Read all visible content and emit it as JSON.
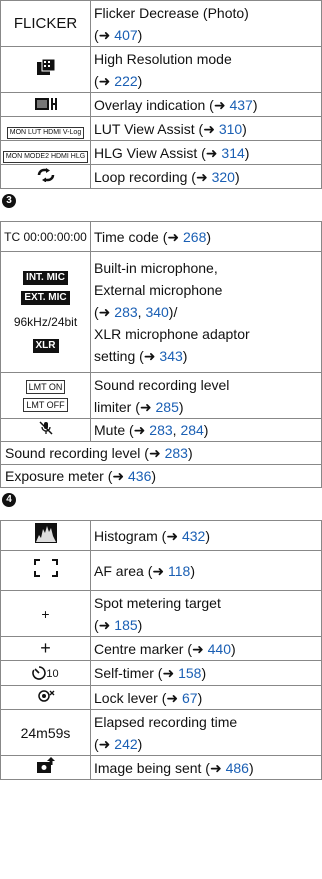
{
  "table1": [
    {
      "icon": "FLICKER",
      "desc": "Flicker Decrease (Photo)",
      "refs": [
        "407"
      ]
    },
    {
      "icon": "high-resolution-icon",
      "desc": "High Resolution mode",
      "refs": [
        "222"
      ]
    },
    {
      "icon": "overlay-icon",
      "desc": "Overlay indication",
      "refs": [
        "437"
      ]
    },
    {
      "icon": "MON LUT HDMI V-Log",
      "desc": "LUT View Assist",
      "refs": [
        "310"
      ]
    },
    {
      "icon": "MON MODE2 HDMI HLG",
      "desc": "HLG View Assist",
      "refs": [
        "314"
      ]
    },
    {
      "icon": "loop-icon",
      "desc": "Loop recording",
      "refs": [
        "320"
      ]
    }
  ],
  "section3": "3",
  "table2": {
    "timecode": {
      "icon": "TC 00:00:00:00",
      "desc": "Time code",
      "refs": [
        "268"
      ]
    },
    "mic": {
      "icons": [
        "INT. MIC",
        "EXT. MIC",
        "96kHz/24bit",
        "XLR"
      ],
      "line1": "Built-in microphone,",
      "line2": "External microphone",
      "refs": [
        "283",
        "340"
      ],
      "line4": "XLR microphone adaptor",
      "line5": "setting",
      "ref5": "343"
    },
    "limiter": {
      "icons": [
        "LMT ON",
        "LMT OFF"
      ],
      "line1": "Sound recording level",
      "line2": "limiter",
      "refs": [
        "285"
      ]
    },
    "mute": {
      "icon": "mute-icon",
      "desc": "Mute",
      "refs": [
        "283",
        "284"
      ]
    },
    "sound_level": {
      "desc": "Sound recording level",
      "refs": [
        "283"
      ]
    },
    "exposure": {
      "desc": "Exposure meter",
      "refs": [
        "436"
      ]
    }
  },
  "section4": "4",
  "table3": [
    {
      "icon": "histogram-icon",
      "desc": "Histogram",
      "refs": [
        "432"
      ]
    },
    {
      "icon": "af-area-icon",
      "desc": "AF area",
      "refs": [
        "118"
      ]
    },
    {
      "icon": "+",
      "desc1": "Spot metering target",
      "refs": [
        "185"
      ]
    },
    {
      "icon": "+",
      "desc": "Centre marker",
      "refs": [
        "440"
      ]
    },
    {
      "icon": "self-timer-icon",
      "label": "10",
      "desc": "Self-timer",
      "refs": [
        "158"
      ]
    },
    {
      "icon": "lock-lever-icon",
      "desc": "Lock lever",
      "refs": [
        "67"
      ]
    },
    {
      "icon": "24m59s",
      "desc1": "Elapsed recording time",
      "refs": [
        "242"
      ]
    },
    {
      "icon": "image-sending-icon",
      "desc": "Image being sent",
      "refs": [
        "486"
      ]
    }
  ]
}
